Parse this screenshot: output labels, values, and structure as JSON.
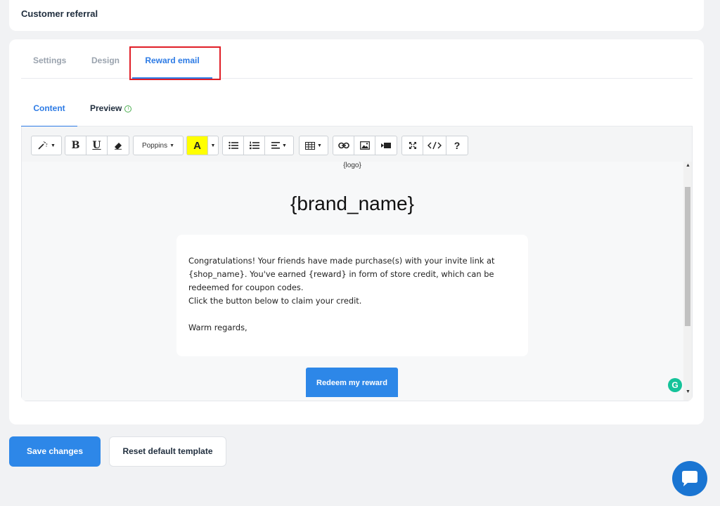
{
  "page": {
    "title": "Customer referral"
  },
  "tabs": [
    {
      "label": "Settings"
    },
    {
      "label": "Design"
    },
    {
      "label": "Reward email"
    }
  ],
  "subtabs": [
    {
      "label": "Content"
    },
    {
      "label": "Preview"
    }
  ],
  "toolbar": {
    "bold": "B",
    "underline": "U",
    "font": "Poppins",
    "font_color": "A",
    "help": "?"
  },
  "email": {
    "logo_placeholder": "{logo}",
    "brand_placeholder": "{brand_name}",
    "body_lines": [
      "Congratulations! Your friends have made purchase(s) with your invite link at",
      "{shop_name}. You've earned {reward} in form of store credit, which can be",
      "redeemed for coupon codes.",
      "Click the button below to claim your credit."
    ],
    "signoff": "Warm regards,",
    "button_label": "Redeem my reward"
  },
  "actions": {
    "save_label": "Save changes",
    "reset_label": "Reset default template"
  },
  "colors": {
    "accent": "#2d7be5",
    "highlight": "#e01e27",
    "font_highlight": "#ffff00",
    "chat": "#1a75d2",
    "grammarly": "#15c39a"
  },
  "icons": [
    "magic-wand-icon",
    "eraser-icon",
    "bullet-list-icon",
    "numbered-list-icon",
    "align-icon",
    "table-icon",
    "link-icon",
    "image-icon",
    "video-icon",
    "fullscreen-icon",
    "code-view-icon",
    "info-icon",
    "chat-icon",
    "grammarly-icon"
  ]
}
